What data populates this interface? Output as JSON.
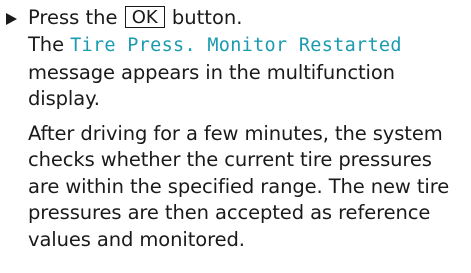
{
  "step": {
    "before_key": "Press the ",
    "key_label": "OK",
    "after_key": " button."
  },
  "result": {
    "before_msg": "The ",
    "display_message": "Tire Press. Monitor Restarted",
    "after_msg": " message appears in the multifunction display."
  },
  "note": {
    "text": "After driving for a few minutes, the system checks whether the current tire pressures are within the specified range. The new tire pressures are then accepted as reference values and monitored."
  },
  "colors": {
    "display_text": "#1a9bb0",
    "body_text": "#1a1a1a"
  },
  "icons": {
    "step_marker": "right-triangle-bullet-icon"
  }
}
